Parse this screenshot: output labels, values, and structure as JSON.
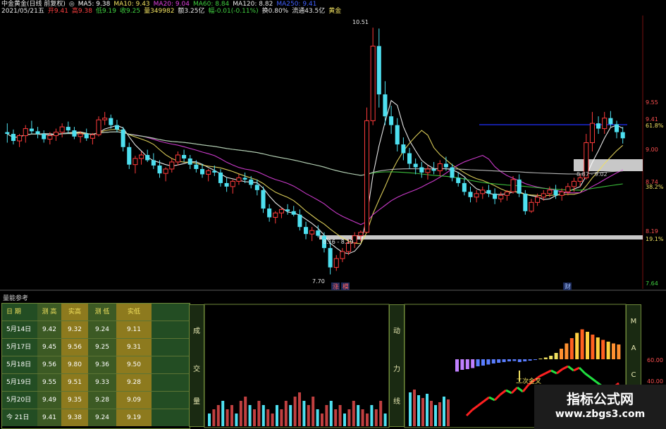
{
  "header": {
    "line1": [
      {
        "text": "中金黄金(日线 前复权)",
        "color": "#e8e8e8"
      },
      {
        "text": "◎",
        "color": "#e8e8e8"
      },
      {
        "text": "MA5: 9.38",
        "color": "#ffffff"
      },
      {
        "text": "MA10: 9.43",
        "color": "#f0e060"
      },
      {
        "text": "MA20: 9.04",
        "color": "#e040e0"
      },
      {
        "text": "MA60: 8.84",
        "color": "#40d040"
      },
      {
        "text": "MA120: 8.82",
        "color": "#e8e8e8"
      },
      {
        "text": "MA250: 9.41",
        "color": "#4060ff"
      }
    ],
    "line2": [
      {
        "text": "2021/05/21五",
        "color": "#e8e8e8"
      },
      {
        "text": "开9.41",
        "color": "#ff4040"
      },
      {
        "text": "高9.38",
        "color": "#ff4040"
      },
      {
        "text": "低9.19",
        "color": "#40d040"
      },
      {
        "text": "收9.25",
        "color": "#40d040"
      },
      {
        "text": "量349982",
        "color": "#f0e060"
      },
      {
        "text": "额3.25亿",
        "color": "#e8e8e8"
      },
      {
        "text": "幅-0.01(-0.11%)",
        "color": "#40d040"
      },
      {
        "text": "换0.80%",
        "color": "#e8e8e8"
      },
      {
        "text": "流通43.5亿",
        "color": "#e8e8e8"
      },
      {
        "text": "黄金",
        "color": "#f0e060"
      }
    ]
  },
  "chart_data": {
    "type": "candlestick",
    "ylim": [
      7.6,
      10.6
    ],
    "price_labels": [
      "9.55",
      "9.41",
      "61.8%",
      "9.00",
      "8.74",
      "38.2%",
      "8.19",
      "19.1%",
      "7.64"
    ],
    "annotations": [
      "10.51",
      "7.70",
      "8.16 - 8.19",
      "8.87 - 9.02"
    ],
    "markers": [
      "涨",
      "模",
      "财"
    ],
    "ohlc": [
      [
        9.32,
        9.42,
        9.2,
        9.3
      ],
      [
        9.3,
        9.35,
        9.18,
        9.22
      ],
      [
        9.22,
        9.3,
        9.15,
        9.28
      ],
      [
        9.28,
        9.4,
        9.2,
        9.36
      ],
      [
        9.36,
        9.45,
        9.3,
        9.33
      ],
      [
        9.33,
        9.38,
        9.25,
        9.3
      ],
      [
        9.3,
        9.34,
        9.2,
        9.24
      ],
      [
        9.24,
        9.32,
        9.18,
        9.28
      ],
      [
        9.28,
        9.36,
        9.22,
        9.32
      ],
      [
        9.32,
        9.42,
        9.26,
        9.38
      ],
      [
        9.38,
        9.44,
        9.3,
        9.34
      ],
      [
        9.34,
        9.38,
        9.24,
        9.27
      ],
      [
        9.27,
        9.33,
        9.2,
        9.3
      ],
      [
        9.3,
        9.36,
        9.22,
        9.25
      ],
      [
        9.25,
        9.31,
        9.18,
        9.29
      ],
      [
        9.29,
        9.5,
        9.27,
        9.46
      ],
      [
        9.46,
        9.55,
        9.4,
        9.48
      ],
      [
        9.48,
        9.52,
        9.36,
        9.4
      ],
      [
        9.4,
        9.46,
        9.32,
        9.35
      ],
      [
        9.35,
        9.38,
        9.1,
        9.15
      ],
      [
        9.15,
        9.2,
        8.9,
        8.95
      ],
      [
        8.95,
        9.05,
        8.85,
        9.02
      ],
      [
        9.02,
        9.1,
        8.95,
        9.06
      ],
      [
        9.06,
        9.12,
        8.98,
        9.0
      ],
      [
        9.0,
        9.08,
        8.9,
        8.94
      ],
      [
        8.94,
        9.0,
        8.8,
        8.85
      ],
      [
        8.85,
        8.92,
        8.76,
        8.9
      ],
      [
        8.9,
        9.02,
        8.86,
        8.98
      ],
      [
        8.98,
        9.1,
        8.94,
        9.06
      ],
      [
        9.06,
        9.12,
        8.98,
        9.02
      ],
      [
        9.02,
        9.06,
        8.9,
        8.95
      ],
      [
        8.95,
        9.0,
        8.86,
        8.9
      ],
      [
        8.9,
        8.96,
        8.8,
        8.84
      ],
      [
        8.84,
        8.9,
        8.76,
        8.88
      ],
      [
        8.88,
        8.94,
        8.82,
        8.86
      ],
      [
        8.86,
        8.9,
        8.7,
        8.74
      ],
      [
        8.74,
        8.8,
        8.64,
        8.7
      ],
      [
        8.7,
        8.78,
        8.62,
        8.76
      ],
      [
        8.76,
        8.84,
        8.72,
        8.8
      ],
      [
        8.8,
        8.86,
        8.74,
        8.78
      ],
      [
        8.78,
        8.82,
        8.68,
        8.72
      ],
      [
        8.72,
        8.78,
        8.6,
        8.66
      ],
      [
        8.66,
        8.7,
        8.4,
        8.45
      ],
      [
        8.45,
        8.5,
        8.3,
        8.35
      ],
      [
        8.35,
        8.42,
        8.28,
        8.4
      ],
      [
        8.4,
        8.46,
        8.34,
        8.44
      ],
      [
        8.44,
        8.5,
        8.38,
        8.42
      ],
      [
        8.42,
        8.48,
        8.36,
        8.38
      ],
      [
        8.38,
        8.44,
        8.2,
        8.24
      ],
      [
        8.24,
        8.3,
        8.1,
        8.16
      ],
      [
        8.16,
        8.24,
        8.08,
        8.2
      ],
      [
        8.2,
        8.26,
        8.12,
        8.14
      ],
      [
        8.14,
        8.18,
        7.95,
        8.0
      ],
      [
        8.0,
        8.08,
        7.7,
        7.78
      ],
      [
        7.78,
        7.92,
        7.74,
        7.88
      ],
      [
        7.88,
        8.0,
        7.84,
        7.96
      ],
      [
        7.96,
        8.1,
        7.92,
        8.06
      ],
      [
        8.06,
        8.18,
        8.0,
        8.14
      ],
      [
        8.14,
        8.2,
        8.08,
        8.18
      ],
      [
        8.18,
        9.6,
        8.18,
        9.45
      ],
      [
        9.45,
        10.51,
        9.4,
        10.3
      ],
      [
        10.3,
        10.5,
        9.6,
        9.75
      ],
      [
        9.75,
        9.9,
        9.4,
        9.5
      ],
      [
        9.5,
        9.62,
        9.3,
        9.4
      ],
      [
        9.4,
        9.48,
        9.1,
        9.18
      ],
      [
        9.18,
        9.26,
        9.0,
        9.08
      ],
      [
        9.08,
        9.14,
        8.9,
        8.96
      ],
      [
        8.96,
        9.02,
        8.84,
        8.92
      ],
      [
        8.92,
        8.98,
        8.8,
        8.86
      ],
      [
        8.86,
        8.94,
        8.78,
        8.9
      ],
      [
        8.9,
        8.98,
        8.84,
        8.88
      ],
      [
        8.88,
        9.0,
        8.82,
        8.96
      ],
      [
        8.96,
        9.04,
        8.88,
        8.92
      ],
      [
        8.92,
        8.96,
        8.76,
        8.8
      ],
      [
        8.8,
        8.86,
        8.7,
        8.74
      ],
      [
        8.74,
        8.8,
        8.6,
        8.64
      ],
      [
        8.64,
        8.7,
        8.52,
        8.58
      ],
      [
        8.58,
        8.66,
        8.52,
        8.62
      ],
      [
        8.62,
        8.7,
        8.56,
        8.66
      ],
      [
        8.66,
        8.72,
        8.58,
        8.62
      ],
      [
        8.62,
        8.68,
        8.5,
        8.56
      ],
      [
        8.56,
        8.64,
        8.52,
        8.6
      ],
      [
        8.6,
        8.66,
        8.54,
        8.64
      ],
      [
        8.64,
        8.82,
        8.62,
        8.78
      ],
      [
        8.78,
        8.84,
        8.58,
        8.62
      ],
      [
        8.62,
        8.66,
        8.38,
        8.42
      ],
      [
        8.42,
        8.56,
        8.4,
        8.52
      ],
      [
        8.52,
        8.62,
        8.48,
        8.58
      ],
      [
        8.58,
        8.66,
        8.54,
        8.62
      ],
      [
        8.62,
        8.7,
        8.58,
        8.66
      ],
      [
        8.66,
        8.72,
        8.56,
        8.6
      ],
      [
        8.6,
        8.68,
        8.54,
        8.64
      ],
      [
        8.64,
        8.74,
        8.6,
        8.7
      ],
      [
        8.7,
        8.8,
        8.64,
        8.76
      ],
      [
        8.76,
        8.84,
        8.7,
        8.8
      ],
      [
        8.8,
        9.3,
        8.78,
        9.2
      ],
      [
        9.2,
        9.55,
        9.1,
        9.42
      ],
      [
        9.42,
        9.5,
        9.3,
        9.36
      ],
      [
        9.36,
        9.55,
        9.3,
        9.48
      ],
      [
        9.48,
        9.56,
        9.38,
        9.41
      ],
      [
        9.41,
        9.45,
        9.25,
        9.32
      ],
      [
        9.32,
        9.38,
        9.19,
        9.25
      ]
    ],
    "ma": [
      {
        "name": "MA5",
        "color": "#ffffff",
        "window": 5
      },
      {
        "name": "MA10",
        "color": "#f0e060",
        "window": 10
      },
      {
        "name": "MA20",
        "color": "#e040e0",
        "window": 20
      },
      {
        "name": "MA60",
        "color": "#40d040",
        "window": 60
      },
      {
        "name": "MA120",
        "color": "#c8c8c8",
        "window": 120
      }
    ],
    "volume": [
      3,
      4,
      5,
      6,
      4,
      5,
      3,
      6,
      7,
      5,
      4,
      6,
      5,
      4,
      3,
      5,
      4,
      6,
      5,
      7,
      8,
      6,
      5,
      7,
      4,
      3,
      5,
      6,
      4,
      5,
      3,
      4,
      6,
      5,
      4,
      3,
      5,
      4,
      6,
      3
    ],
    "momentum": [
      -0.35,
      -0.3,
      -0.28,
      -0.25,
      -0.2,
      -0.18,
      -0.15,
      -0.12,
      -0.1,
      -0.08,
      -0.06,
      -0.05,
      -0.08,
      -0.06,
      -0.04,
      -0.02,
      0.02,
      0.05,
      0.1,
      0.18,
      0.3,
      0.45,
      0.6,
      0.75,
      0.85,
      0.78,
      0.7,
      0.62,
      0.55,
      0.5,
      0.45,
      0.42
    ]
  },
  "panel": {
    "title": "量能参考",
    "table_headers": [
      "日 期",
      "测 高",
      "实高",
      "测 低",
      "实低"
    ],
    "table_rows": [
      [
        "5月14日",
        "9.42",
        "9.32",
        "9.24",
        "9.11"
      ],
      [
        "5月17日",
        "9.45",
        "9.56",
        "9.25",
        "9.31"
      ],
      [
        "5月18日",
        "9.56",
        "9.80",
        "9.36",
        "9.50"
      ],
      [
        "5月19日",
        "9.55",
        "9.51",
        "9.33",
        "9.28"
      ],
      [
        "5月20日",
        "9.49",
        "9.35",
        "9.28",
        "9.09"
      ],
      [
        "今  21日",
        "9.41",
        "9.38",
        "9.24",
        "9.19"
      ]
    ],
    "volume_label": [
      "成",
      "交",
      "量"
    ],
    "momentum_label": [
      "动",
      "力",
      "线"
    ],
    "mac_label": [
      "M",
      "A",
      "C"
    ],
    "annotation": "二次金叉",
    "right_ticks": [
      "60.00",
      "40.00"
    ]
  },
  "watermark": {
    "title": "指标公式网",
    "url": "www.zbgs3.com"
  }
}
